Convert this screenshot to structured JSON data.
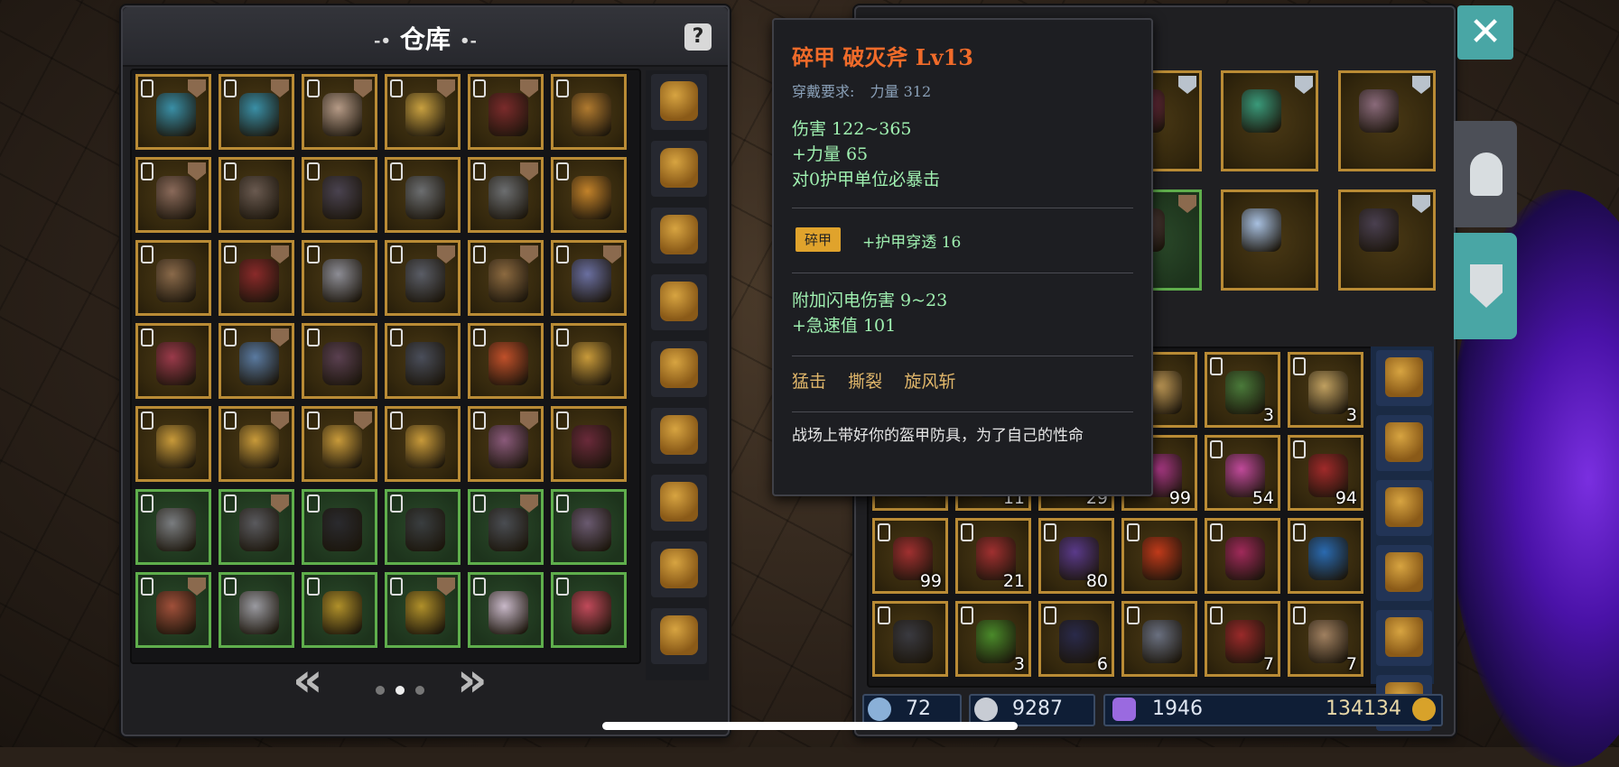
{
  "warehouse": {
    "title": "仓库",
    "title_deco_left": "-•",
    "title_deco_right": "•-",
    "help_label": "?",
    "pager_prev": "«",
    "pager_next": "»",
    "page_dots": 3,
    "active_dot": 1,
    "slots": [
      {
        "frame": "gold",
        "badge": "bronze",
        "icon": "fish-necklace-icon",
        "color": "#3a8fa6"
      },
      {
        "frame": "gold",
        "badge": "bronze",
        "icon": "fish-necklace-icon",
        "color": "#3a8fa6"
      },
      {
        "frame": "gold",
        "badge": "bronze",
        "icon": "gauntlet-icon",
        "color": "#b59a86"
      },
      {
        "frame": "gold",
        "badge": "bronze",
        "icon": "amulet-icon",
        "color": "#c8a040"
      },
      {
        "frame": "gold",
        "badge": "bronze",
        "icon": "mace-icon",
        "color": "#7a2b2b"
      },
      {
        "frame": "gold",
        "badge": "none",
        "icon": "claw-ring-icon",
        "color": "#b07a2f"
      },
      {
        "frame": "gold",
        "badge": "bronze",
        "icon": "leather-armor-icon",
        "color": "#8a6a5a"
      },
      {
        "frame": "gold",
        "badge": "none",
        "icon": "crossbow-icon",
        "color": "#6a5a50"
      },
      {
        "frame": "gold",
        "badge": "none",
        "icon": "dark-armor-icon",
        "color": "#4a4350"
      },
      {
        "frame": "gold",
        "badge": "none",
        "icon": "emerald-ring-icon",
        "color": "#6c6e70"
      },
      {
        "frame": "gold",
        "badge": "bronze",
        "icon": "emerald-ring-icon",
        "color": "#6c6e70"
      },
      {
        "frame": "gold",
        "badge": "none",
        "icon": "gold-ring-icon",
        "color": "#c2822a"
      },
      {
        "frame": "gold",
        "badge": "none",
        "icon": "spear-icon",
        "color": "#8a6a4a"
      },
      {
        "frame": "gold",
        "badge": "bronze",
        "icon": "demon-claw-icon",
        "color": "#8a2a2a"
      },
      {
        "frame": "gold",
        "badge": "none",
        "icon": "battle-axe-icon",
        "color": "#8d8d95"
      },
      {
        "frame": "gold",
        "badge": "bronze",
        "icon": "war-axe-icon",
        "color": "#5a5d66"
      },
      {
        "frame": "gold",
        "badge": "bronze",
        "icon": "staff-icon",
        "color": "#8c6a40"
      },
      {
        "frame": "gold",
        "badge": "bronze",
        "icon": "plate-armor-icon",
        "color": "#6a6fa0"
      },
      {
        "frame": "gold",
        "badge": "none",
        "icon": "royal-armor-icon",
        "color": "#9a3a4a"
      },
      {
        "frame": "gold",
        "badge": "bronze",
        "icon": "blue-gauntlet-icon",
        "color": "#5a7aa0"
      },
      {
        "frame": "gold",
        "badge": "none",
        "icon": "dark-gauntlet-icon",
        "color": "#5a4050"
      },
      {
        "frame": "gold",
        "badge": "none",
        "icon": "iron-gauntlet-icon",
        "color": "#4a4e5a"
      },
      {
        "frame": "gold",
        "badge": "none",
        "icon": "ruby-amulet-icon",
        "color": "#c0502a"
      },
      {
        "frame": "gold",
        "badge": "none",
        "icon": "jeweled-ring-icon",
        "color": "#c89a3a"
      },
      {
        "frame": "gold",
        "badge": "none",
        "icon": "jeweled-ring-icon",
        "color": "#c89a3a"
      },
      {
        "frame": "gold",
        "badge": "bronze",
        "icon": "jeweled-ring-icon",
        "color": "#c89a3a"
      },
      {
        "frame": "gold",
        "badge": "bronze",
        "icon": "jeweled-ring-icon",
        "color": "#c89a3a"
      },
      {
        "frame": "gold",
        "badge": "none",
        "icon": "jeweled-ring-icon",
        "color": "#c89a3a"
      },
      {
        "frame": "gold",
        "badge": "bronze",
        "icon": "spiked-mace-icon",
        "color": "#8a5a7a"
      },
      {
        "frame": "gold",
        "badge": "none",
        "icon": "dragon-claw-icon",
        "color": "#6a2a3a"
      },
      {
        "frame": "green",
        "badge": "none",
        "icon": "skull-helm-icon",
        "color": "#7a7d80"
      },
      {
        "frame": "green",
        "badge": "bronze",
        "icon": "iron-helm-icon",
        "color": "#5a5a5e"
      },
      {
        "frame": "green",
        "badge": "none",
        "icon": "shadow-cloak-icon",
        "color": "#2a2a2e"
      },
      {
        "frame": "green",
        "badge": "none",
        "icon": "black-gauntlet-icon",
        "color": "#3a3e40"
      },
      {
        "frame": "green",
        "badge": "bronze",
        "icon": "knight-armor-icon",
        "color": "#4a4d52"
      },
      {
        "frame": "green",
        "badge": "none",
        "icon": "spiked-armor-icon",
        "color": "#6a5a70"
      },
      {
        "frame": "green",
        "badge": "bronze",
        "icon": "crimson-spear-icon",
        "color": "#a0503a"
      },
      {
        "frame": "green",
        "badge": "none",
        "icon": "scimitar-icon",
        "color": "#9a9aa0"
      },
      {
        "frame": "green",
        "badge": "none",
        "icon": "golden-dagger-icon",
        "color": "#b0902a"
      },
      {
        "frame": "green",
        "badge": "bronze",
        "icon": "golden-dagger-icon",
        "color": "#b0902a"
      },
      {
        "frame": "green",
        "badge": "none",
        "icon": "bone-armor-icon",
        "color": "#c8b8c8"
      },
      {
        "frame": "green",
        "badge": "none",
        "icon": "red-robe-icon",
        "color": "#c04a5a"
      }
    ],
    "side_bags": 9
  },
  "tooltip": {
    "title": "碎甲  破灭斧  Lv13",
    "requirement_label": "穿戴要求:",
    "requirement_value": "力量 312",
    "damage": "伤害  122~365",
    "stat_strength": "+力量  65",
    "crit_note": "对0护甲单位必暴击",
    "affix_tag": "碎甲",
    "affix_text": "+护甲穿透  16",
    "lightning": "附加闪电伤害  9~23",
    "haste": "+急速值  101",
    "skills": "猛击    撕裂    旋风斩",
    "flavor": "战场上带好你的盔甲防具，为了自己的性命"
  },
  "equipment": {
    "slots": [
      {
        "badge": "silver",
        "icon": "royal-armor-icon",
        "color": "#9a3a5a",
        "frame": "gold"
      },
      {
        "badge": "silver",
        "icon": "jade-ring-icon",
        "color": "#3a9a7a",
        "frame": "gold"
      },
      {
        "badge": "silver",
        "icon": "claw-blade-icon",
        "color": "#8a6a7a",
        "frame": "gold"
      },
      {
        "badge": "bronze",
        "icon": "chest-plate-icon",
        "color": "#6a5050",
        "frame": "green"
      },
      {
        "badge": "none",
        "icon": "sapphire-ring-icon",
        "color": "#a8c0e0",
        "frame": "gold"
      },
      {
        "badge": "silver",
        "icon": "shadow-armor-icon",
        "color": "#4a4050",
        "frame": "gold"
      }
    ]
  },
  "inventory": {
    "slots": [
      {
        "icon": "rune-scroll-icon",
        "qty": "",
        "color": "#c8a05a"
      },
      {
        "icon": "rune-tablet-icon",
        "qty": "3",
        "color": "#4a7a3a"
      },
      {
        "icon": "map-scroll-icon",
        "qty": "3",
        "color": "#c0a060"
      },
      {
        "icon": "red-gem-icon",
        "qty": "99",
        "color": "#b03a8a"
      },
      {
        "icon": "pink-gem-icon",
        "qty": "54",
        "color": "#c04a9a"
      },
      {
        "icon": "red-crystal-icon",
        "qty": "94",
        "color": "#a02a2a"
      },
      {
        "icon": "blue-ore-icon",
        "qty": "",
        "color": "#3a5a9a"
      },
      {
        "icon": "blue-ore-icon",
        "qty": "11",
        "color": "#3a5a9a"
      },
      {
        "icon": "stone-icon",
        "qty": "29",
        "color": "#6a5a4a"
      },
      {
        "icon": "ruby-ore-icon",
        "qty": "99",
        "color": "#a03030"
      },
      {
        "icon": "ruby-ore-icon",
        "qty": "21",
        "color": "#a03030"
      },
      {
        "icon": "amethyst-ore-icon",
        "qty": "80",
        "color": "#5a3a8a"
      },
      {
        "icon": "fire-crystal-icon",
        "qty": "",
        "color": "#c03a1a"
      },
      {
        "icon": "magenta-orb-icon",
        "qty": "",
        "color": "#a02a5a"
      },
      {
        "icon": "frost-core-icon",
        "qty": "",
        "color": "#2a6ab0"
      },
      {
        "icon": "coal-ore-icon",
        "qty": "",
        "color": "#3a3a40"
      },
      {
        "icon": "green-potion-icon",
        "qty": "3",
        "color": "#4a8a2a"
      },
      {
        "icon": "dark-shard-icon",
        "qty": "6",
        "color": "#2a2a4a"
      },
      {
        "icon": "iron-ore-icon",
        "qty": "",
        "color": "#6a7080"
      },
      {
        "icon": "red-crystal-icon",
        "qty": "7",
        "color": "#9a2a2a"
      },
      {
        "icon": "horn-icon",
        "qty": "7",
        "color": "#a08060"
      }
    ],
    "side_bags": 6
  },
  "currencies": {
    "wand_value": "72",
    "potion_value": "9287",
    "gem_value": "1946",
    "gold_value": "134134"
  },
  "close_label": "✕",
  "colors": {
    "gold_frame": "#b98b35",
    "green_frame": "#5fae4c",
    "tooltip_title": "#f06b2a",
    "tooltip_stat": "#9ff0b0",
    "tooltip_req": "#8aa0b8",
    "tooltip_skill": "#e0b66a",
    "accent_teal": "#49a6a5"
  }
}
